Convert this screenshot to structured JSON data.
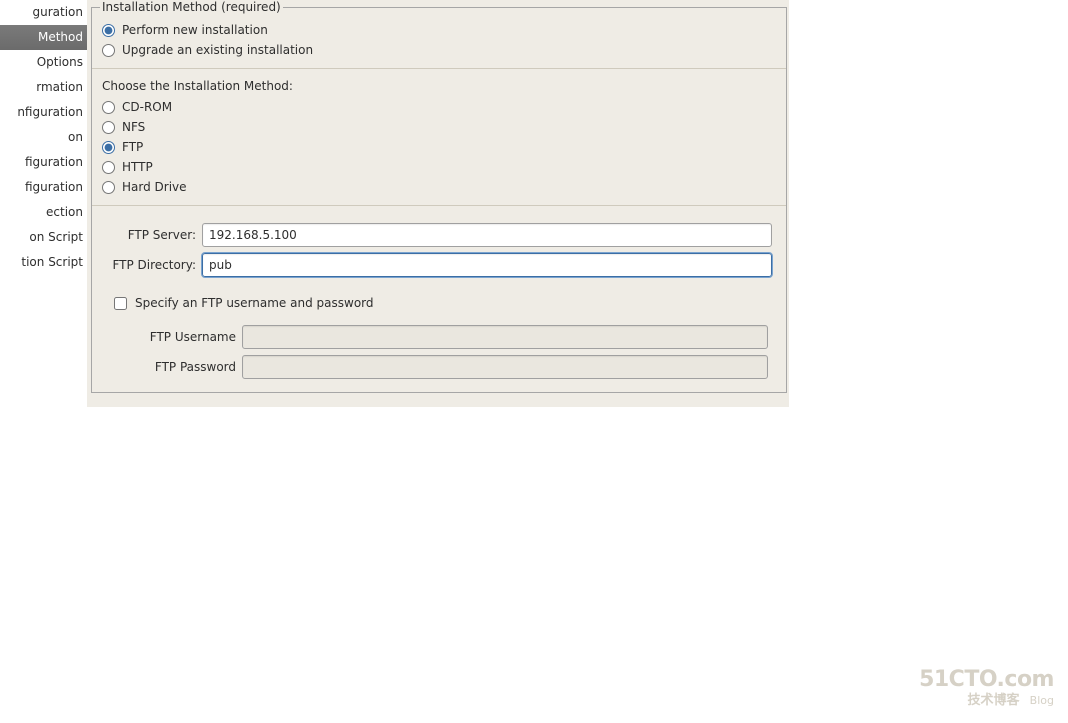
{
  "sidebar": {
    "items": [
      {
        "label": "guration"
      },
      {
        "label": "Method"
      },
      {
        "label": " Options"
      },
      {
        "label": "rmation"
      },
      {
        "label": "nfiguration"
      },
      {
        "label": "on"
      },
      {
        "label": "figuration"
      },
      {
        "label": "figuration"
      },
      {
        "label": "ection"
      },
      {
        "label": "on Script"
      },
      {
        "label": "tion Script"
      }
    ],
    "selected_index": 1
  },
  "panel": {
    "fieldset_legend": "Installation Method (required)",
    "install_type": {
      "options": [
        {
          "label": "Perform new installation",
          "selected": true
        },
        {
          "label": "Upgrade an existing installation",
          "selected": false
        }
      ]
    },
    "method_label": "Choose the Installation Method:",
    "methods": [
      {
        "label": "CD-ROM",
        "selected": false
      },
      {
        "label": "NFS",
        "selected": false
      },
      {
        "label": "FTP",
        "selected": true
      },
      {
        "label": "HTTP",
        "selected": false
      },
      {
        "label": "Hard Drive",
        "selected": false
      }
    ],
    "ftp": {
      "server_label": "FTP Server:",
      "server_value": "192.168.5.100",
      "directory_label": "FTP Directory:",
      "directory_value": "pub",
      "specify_creds_label": "Specify an FTP username and password",
      "specify_creds_checked": false,
      "username_label": "FTP Username",
      "username_value": "",
      "password_label": "FTP Password",
      "password_value": ""
    }
  },
  "watermark": {
    "line1": "51CTO.com",
    "line2": "技术博客",
    "line2b": "Blog"
  }
}
